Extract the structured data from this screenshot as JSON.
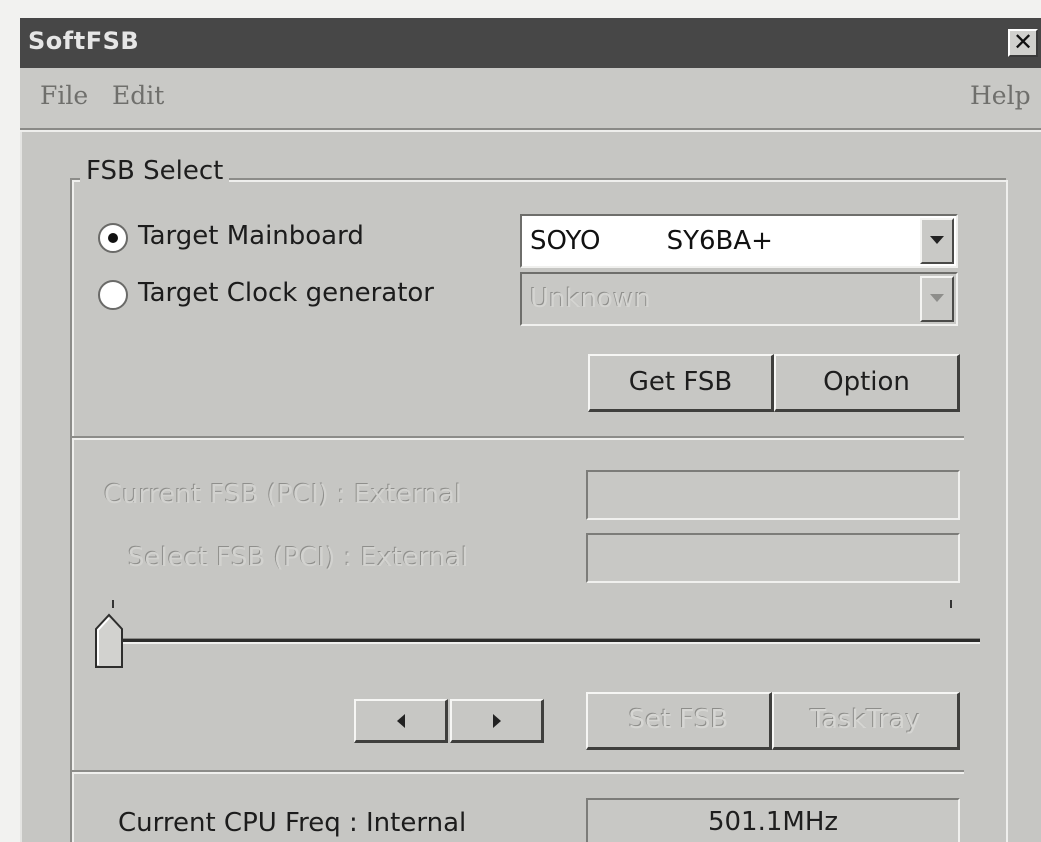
{
  "window": {
    "title": "SoftFSB"
  },
  "menu": {
    "file": "File",
    "edit": "Edit",
    "help": "Help"
  },
  "group": {
    "label": "FSB Select"
  },
  "target": {
    "mainboard_label": "Target Mainboard",
    "clock_label": "Target Clock generator",
    "selected": "mainboard",
    "mainboard_value": "SOYO        SY6BA+",
    "clock_value": "Unknown"
  },
  "buttons": {
    "get_fsb": "Get FSB",
    "option": "Option",
    "set_fsb": "Set FSB",
    "task_tray": "TaskTray"
  },
  "fsb": {
    "current_label": "Current FSB (PCI) : External",
    "current_value": "",
    "select_label": "Select FSB (PCI) : External",
    "select_value": "",
    "slider_level": 0
  },
  "cpu": {
    "label": "Current CPU Freq : Internal",
    "value": "501.1MHz"
  },
  "icons": {
    "close": "close-icon",
    "left": "arrow-left-icon",
    "right": "arrow-right-icon",
    "dropdown": "chevron-down-icon"
  }
}
